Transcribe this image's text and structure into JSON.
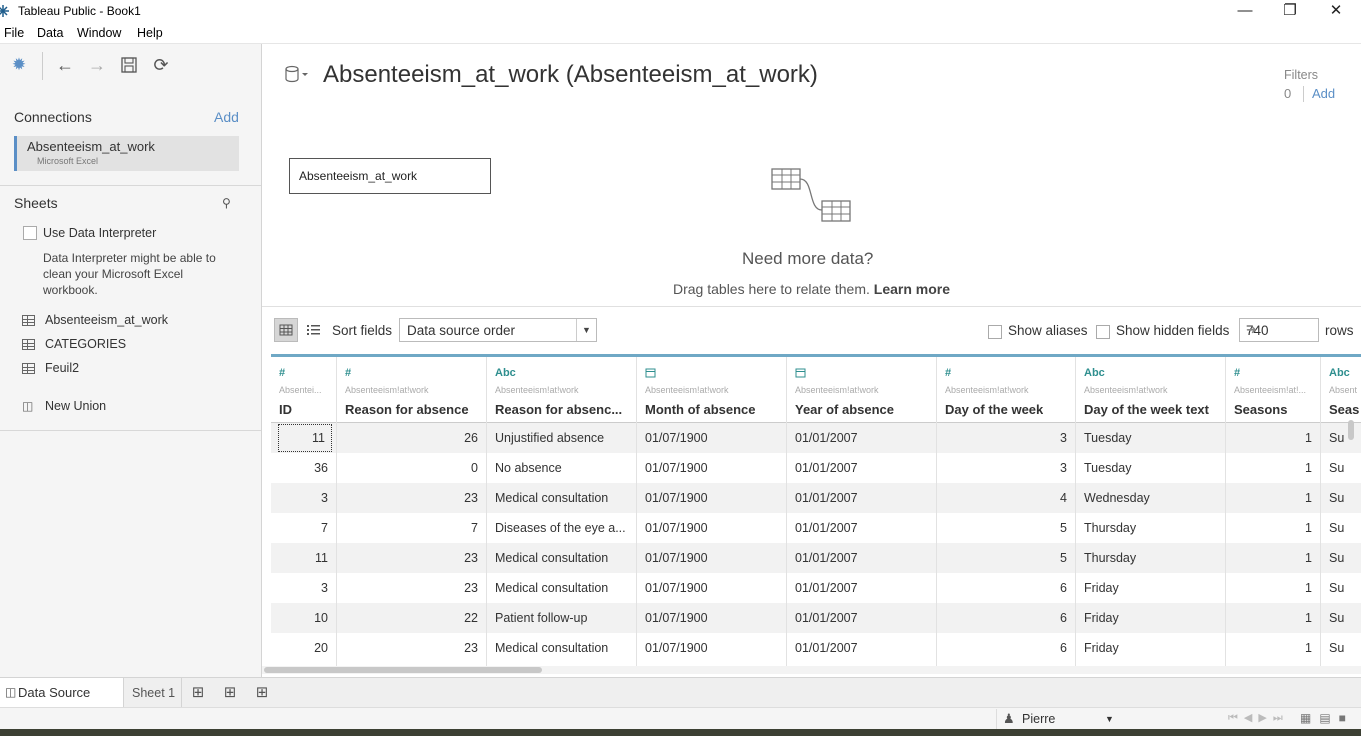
{
  "window": {
    "title": "Tableau Public - Book1"
  },
  "menu": [
    "File",
    "Data",
    "Window",
    "Help"
  ],
  "connections": {
    "title": "Connections",
    "add_label": "Add",
    "items": [
      {
        "name": "Absenteeism_at_work",
        "type": "Microsoft Excel"
      }
    ]
  },
  "sheets": {
    "title": "Sheets",
    "interpreter_label": "Use Data Interpreter",
    "interpreter_hint_lines": [
      "Data Interpreter might be able to",
      "clean your Microsoft Excel",
      "workbook."
    ],
    "items": [
      "Absenteeism_at_work",
      "CATEGORIES",
      "Feuil2"
    ],
    "new_union": "New Union"
  },
  "datasource": {
    "title": "Absenteeism_at_work (Absenteeism_at_work)",
    "filters_label": "Filters",
    "filters_count": "0",
    "filters_add": "Add",
    "canvas_table": "Absenteeism_at_work",
    "need_more": "Need more data?",
    "drag_hint": "Drag tables here to relate them.",
    "learn_more": "Learn more"
  },
  "grid_toolbar": {
    "sort_label": "Sort fields",
    "sort_value": "Data source order",
    "show_aliases": "Show aliases",
    "show_hidden": "Show hidden fields",
    "rows_value": "740",
    "rows_label": "rows"
  },
  "columns": [
    {
      "type": "#",
      "src": "Absentei...",
      "name": "ID"
    },
    {
      "type": "#",
      "src": "Absenteeism!at!work",
      "name": "Reason for absence"
    },
    {
      "type": "Abc",
      "src": "Absenteeism!at!work",
      "name": "Reason for absenc..."
    },
    {
      "type": "date",
      "src": "Absenteeism!at!work",
      "name": "Month of absence"
    },
    {
      "type": "date",
      "src": "Absenteeism!at!work",
      "name": "Year of absence"
    },
    {
      "type": "#",
      "src": "Absenteeism!at!work",
      "name": "Day of the week"
    },
    {
      "type": "Abc",
      "src": "Absenteeism!at!work",
      "name": "Day of the week text"
    },
    {
      "type": "#",
      "src": "Absenteeism!at!...",
      "name": "Seasons"
    },
    {
      "type": "Abc",
      "src": "Absent",
      "name": "Seas"
    }
  ],
  "rows": [
    [
      "11",
      "26",
      "Unjustified absence",
      "01/07/1900",
      "01/01/2007",
      "3",
      "Tuesday",
      "1",
      "Su"
    ],
    [
      "36",
      "0",
      "No absence",
      "01/07/1900",
      "01/01/2007",
      "3",
      "Tuesday",
      "1",
      "Su"
    ],
    [
      "3",
      "23",
      "Medical consultation",
      "01/07/1900",
      "01/01/2007",
      "4",
      "Wednesday",
      "1",
      "Su"
    ],
    [
      "7",
      "7",
      "Diseases of the eye a...",
      "01/07/1900",
      "01/01/2007",
      "5",
      "Thursday",
      "1",
      "Su"
    ],
    [
      "11",
      "23",
      "Medical consultation",
      "01/07/1900",
      "01/01/2007",
      "5",
      "Thursday",
      "1",
      "Su"
    ],
    [
      "3",
      "23",
      "Medical consultation",
      "01/07/1900",
      "01/01/2007",
      "6",
      "Friday",
      "1",
      "Su"
    ],
    [
      "10",
      "22",
      "Patient follow-up",
      "01/07/1900",
      "01/01/2007",
      "6",
      "Friday",
      "1",
      "Su"
    ],
    [
      "20",
      "23",
      "Medical consultation",
      "01/07/1900",
      "01/01/2007",
      "6",
      "Friday",
      "1",
      "Su"
    ]
  ],
  "tabs": {
    "data_source": "Data Source",
    "sheet1": "Sheet 1"
  },
  "status": {
    "user": "Pierre"
  },
  "colors": {
    "accent": "#5b8fc6",
    "grid_top": "#6fa8c5",
    "field_icon": "#2f8f8f"
  }
}
